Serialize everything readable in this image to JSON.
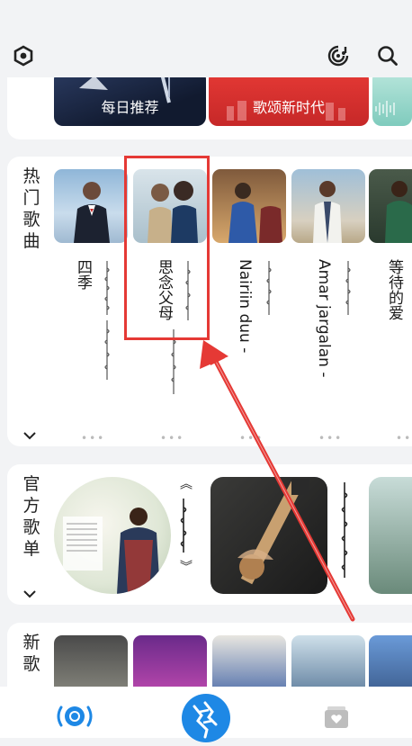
{
  "header": {
    "left_icon": "hexagon-settings-icon",
    "right_icons": [
      "music-recognition-icon",
      "search-icon"
    ]
  },
  "banners": [
    {
      "label": "每日推荐"
    },
    {
      "label": "歌颂新时代"
    }
  ],
  "hot_songs": {
    "title": "热门歌曲",
    "items": [
      {
        "title": "四季"
      },
      {
        "title": "思念父母"
      },
      {
        "title": "Nairiin duu -"
      },
      {
        "title": "Amar jargalan -"
      },
      {
        "title": "等待的爱"
      }
    ]
  },
  "official_playlists": {
    "title": "官方歌单",
    "items": [
      {
        "quote_open": "《",
        "quote_close": "》"
      },
      {}
    ]
  },
  "new_songs": {
    "title": "新歌"
  },
  "bottom_nav": [
    {
      "icon": "radar-icon",
      "active": true
    },
    {
      "icon": "mongolian-script-logo-icon"
    },
    {
      "icon": "music-library-icon"
    }
  ],
  "colors": {
    "accent": "#1e88e5",
    "highlight": "#e53935",
    "background": "#f2f3f5"
  }
}
